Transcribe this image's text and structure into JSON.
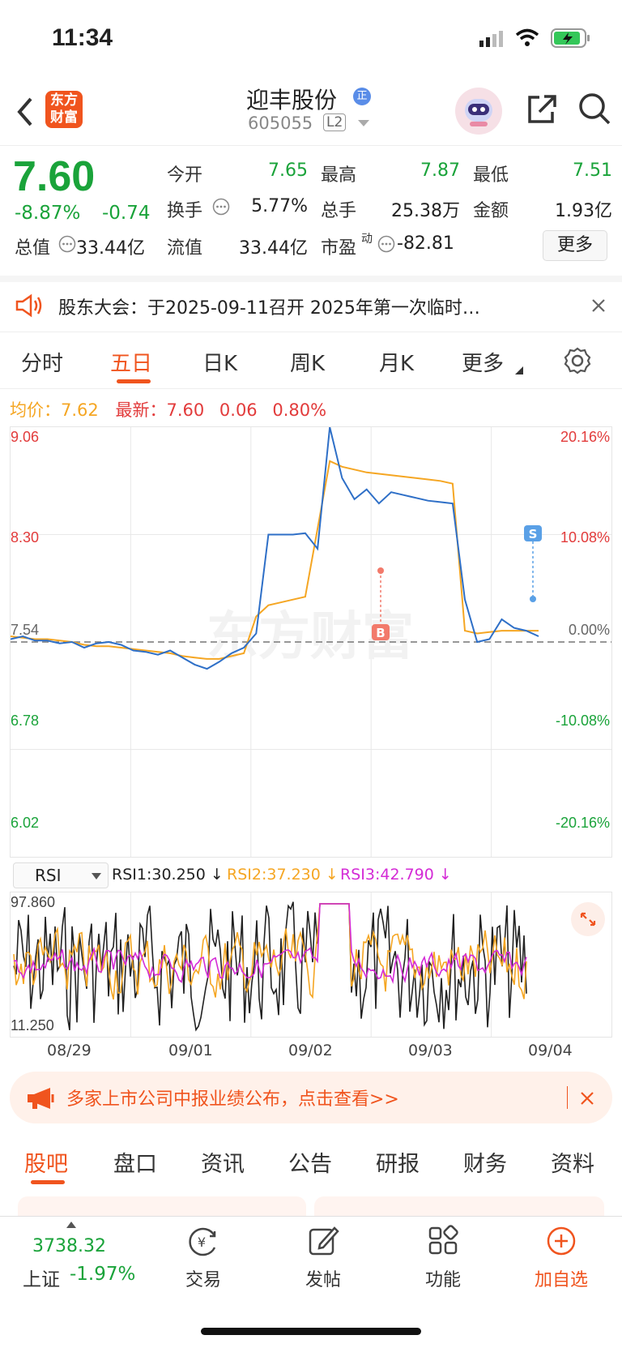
{
  "status_bar": {
    "time": "11:34"
  },
  "header": {
    "app_logo_text": "东方财富",
    "stock_name": "迎丰股份",
    "name_badge": "正",
    "stock_code": "605055",
    "level_badge": "L2"
  },
  "quote": {
    "price": "7.60",
    "change_pct": "-8.87%",
    "change": "-0.74",
    "open_label": "今开",
    "open": "7.65",
    "high_label": "最高",
    "high": "7.87",
    "low_label": "最低",
    "low": "7.51",
    "turnover_label": "换手",
    "turnover": "5.77%",
    "volume_label": "总手",
    "volume": "25.38万",
    "amount_label": "金额",
    "amount": "1.93亿",
    "mktcap_label": "总值",
    "mktcap": "33.44亿",
    "float_label": "流值",
    "float_cap": "33.44亿",
    "pe_label": "市盈",
    "pe_sup": "动",
    "pe": "-82.81",
    "more_button": "更多"
  },
  "notice": {
    "text": "股东大会：于2025-09-11召开 2025年第一次临时…"
  },
  "tabs": [
    "分时",
    "五日",
    "日K",
    "周K",
    "月K",
    "更多"
  ],
  "active_tab": "五日",
  "chart_info": {
    "avg_label": "均价：",
    "avg": "7.62",
    "latest_label": "最新：",
    "latest": "7.60",
    "latest_change": "0.06",
    "latest_pct": "0.80%"
  },
  "chart_data": {
    "type": "line",
    "title": "",
    "y_left_ticks": [
      "9.06",
      "8.30",
      "7.54",
      "6.78",
      "6.02"
    ],
    "y_right_ticks": [
      "20.16%",
      "10.08%",
      "0.00%",
      "-10.08%",
      "-20.16%"
    ],
    "ylim": [
      6.02,
      9.06
    ],
    "reference_price": 7.54,
    "x_days": [
      "08/29",
      "09/01",
      "09/02",
      "09/03",
      "09/04"
    ],
    "series": [
      {
        "name": "",
        "color": "#2e6fc7",
        "values": [
          7.56,
          7.58,
          7.55,
          7.55,
          7.53,
          7.54,
          7.5,
          7.53,
          7.54,
          7.52,
          7.48,
          7.47,
          7.45,
          7.48,
          7.43,
          7.38,
          7.35,
          7.4,
          7.46,
          7.5,
          7.6,
          8.3,
          8.3,
          8.3,
          8.31,
          8.2,
          9.06,
          8.7,
          8.55,
          8.62,
          8.52,
          8.6,
          8.58,
          8.56,
          8.54,
          8.53,
          8.52,
          7.84,
          7.54,
          7.56,
          7.7,
          7.64,
          7.62,
          7.58
        ]
      },
      {
        "name": "",
        "color": "#f5a623",
        "values": [
          7.58,
          7.57,
          7.56,
          7.56,
          7.55,
          7.54,
          7.52,
          7.51,
          7.51,
          7.5,
          7.49,
          7.48,
          7.47,
          7.46,
          7.44,
          7.43,
          7.42,
          7.42,
          7.44,
          7.46,
          7.72,
          7.8,
          7.82,
          7.84,
          7.86,
          null,
          8.82,
          8.78,
          8.76,
          8.74,
          8.73,
          8.72,
          8.71,
          8.7,
          8.69,
          8.68,
          8.66,
          7.62,
          7.6,
          7.61,
          7.62,
          7.62,
          7.62,
          7.62
        ]
      }
    ],
    "markers": [
      {
        "label": "B",
        "color": "#f27a6b"
      },
      {
        "label": "S",
        "color": "#5aa0e6"
      }
    ]
  },
  "rsi": {
    "selector": "RSI",
    "rsi1": "RSI1:30.250 ↓",
    "rsi2": "RSI2:37.230 ↓",
    "rsi3": "RSI3:42.790 ↓",
    "top": "97.860",
    "bottom": "11.250"
  },
  "promo": {
    "text": "多家上市公司中报业绩公布，点击查看>>"
  },
  "subtabs": [
    "股吧",
    "盘口",
    "资讯",
    "公告",
    "研报",
    "财务",
    "资料"
  ],
  "bottom_nav": {
    "index_value": "3738.32",
    "index_name": "上证",
    "index_change": "-1.97%",
    "items": [
      "交易",
      "发帖",
      "功能",
      "加自选"
    ]
  },
  "colors": {
    "up": "#e23b3b",
    "down": "#1aa33a",
    "accent": "#f0541e",
    "price_line": "#2e6fc7",
    "avg_line": "#f5a623"
  }
}
